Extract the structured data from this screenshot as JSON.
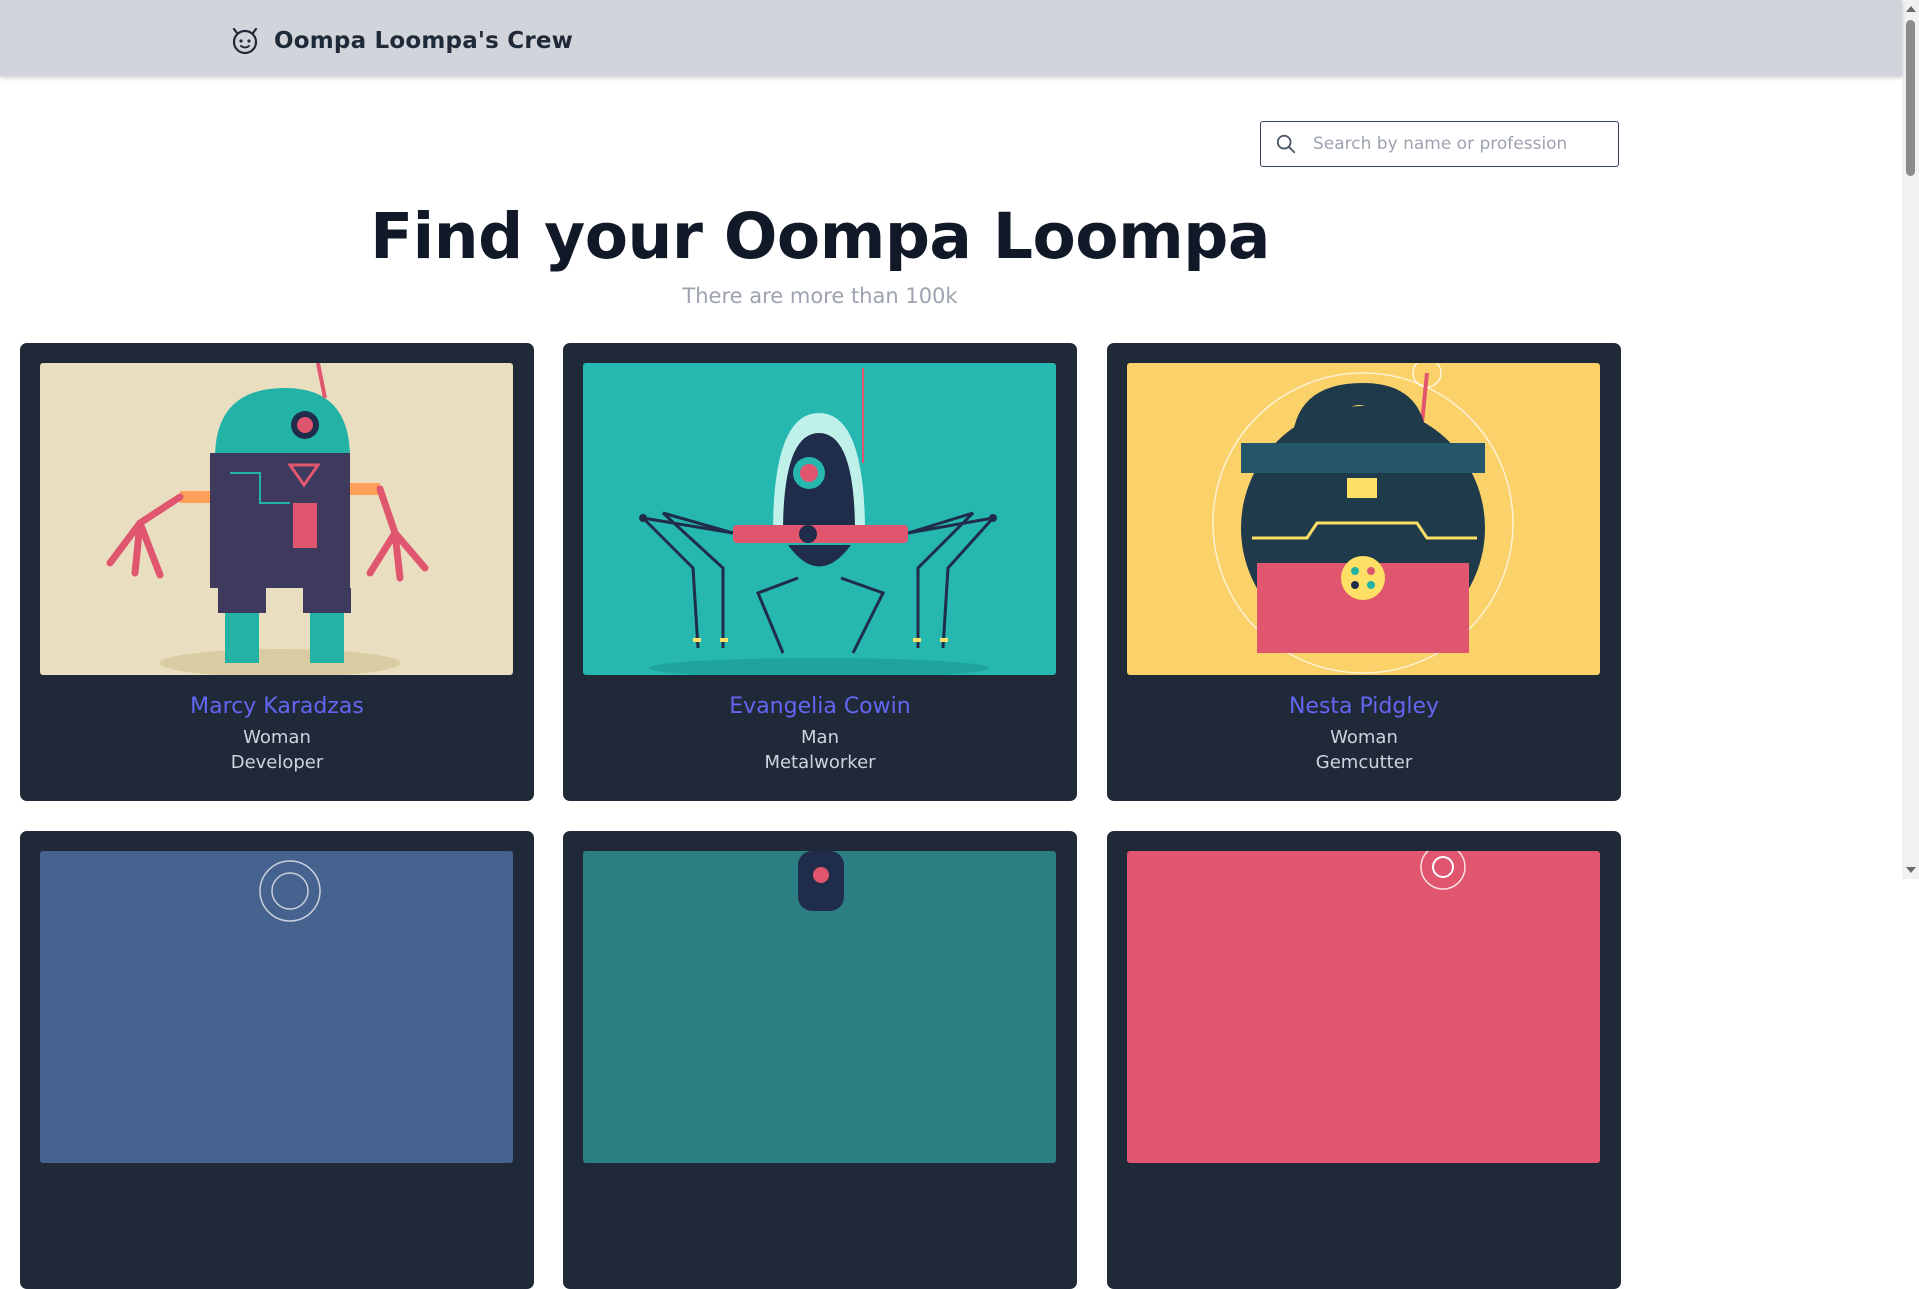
{
  "header": {
    "title": "Oompa Loompa's Crew",
    "logo_icon": "robot-face-icon"
  },
  "search": {
    "placeholder": "Search by name or profession",
    "value": ""
  },
  "hero": {
    "title": "Find your Oompa Loompa",
    "subtitle": "There are more than 100k"
  },
  "cards": [
    {
      "name": "Marcy Karadzas",
      "gender": "Woman",
      "profession": "Developer",
      "bg_color": "#e9dfc0"
    },
    {
      "name": "Evangelia Cowin",
      "gender": "Man",
      "profession": "Metalworker",
      "bg_color": "#26b8b0"
    },
    {
      "name": "Nesta Pidgley",
      "gender": "Woman",
      "profession": "Gemcutter",
      "bg_color": "#fbd169"
    },
    {
      "name": "",
      "gender": "",
      "profession": "",
      "bg_color": "#46628f"
    },
    {
      "name": "",
      "gender": "",
      "profession": "",
      "bg_color": "#2b7f83"
    },
    {
      "name": "",
      "gender": "",
      "profession": "",
      "bg_color": "#e0566f"
    }
  ],
  "colors": {
    "header_bg": "#d1d5db",
    "card_bg": "#1f2937",
    "name_accent": "#6366f1",
    "subtitle_gray": "#9ca3af"
  }
}
